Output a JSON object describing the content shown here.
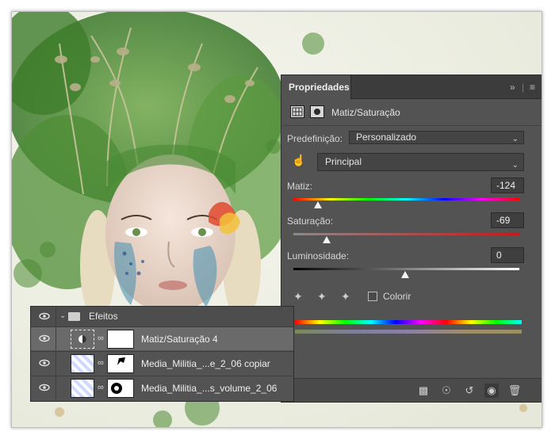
{
  "properties_panel": {
    "tab_label": "Propriedades",
    "expand_icon": "double-chevron-right-icon",
    "menu_icon": "panel-menu-icon",
    "header_title": "Matiz/Saturação",
    "preset_label": "Predefinição:",
    "preset_value": "Personalizado",
    "channel_value": "Principal",
    "hue_label": "Matiz:",
    "hue_value": "-124",
    "saturation_label": "Saturação:",
    "saturation_value": "-69",
    "lightness_label": "Luminosidade:",
    "lightness_value": "0",
    "colorize_label": "Colorir",
    "colorize_checked": false,
    "footer_icons": [
      "clip-to-layer-icon",
      "view-previous-state-icon",
      "reset-icon",
      "visibility-eye-icon",
      "trash-icon"
    ]
  },
  "layers_panel": {
    "group_name": "Efeitos",
    "layers": [
      {
        "name": "Matiz/Saturação 4",
        "selected": true
      },
      {
        "name": "Media_Militia_...e_2_06 copiar",
        "selected": false
      },
      {
        "name": "Media_Militia_...s_volume_2_06",
        "selected": false
      }
    ]
  },
  "colors": {
    "panel_bg": "#535353",
    "tabbar_bg": "#3c3c3c",
    "selected_row": "#6a6a6a",
    "artwork_green": "#3f8a2e"
  }
}
